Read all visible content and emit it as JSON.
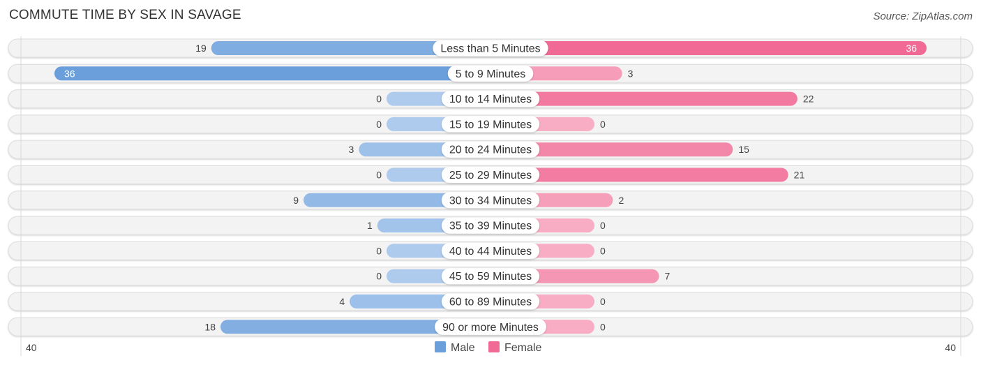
{
  "title": "COMMUTE TIME BY SEX IN SAVAGE",
  "source": "Source: ZipAtlas.com",
  "chart_data": {
    "type": "bar",
    "orientation": "horizontal-diverging",
    "title": "COMMUTE TIME BY SEX IN SAVAGE",
    "categories": [
      "Less than 5 Minutes",
      "5 to 9 Minutes",
      "10 to 14 Minutes",
      "15 to 19 Minutes",
      "20 to 24 Minutes",
      "25 to 29 Minutes",
      "30 to 34 Minutes",
      "35 to 39 Minutes",
      "40 to 44 Minutes",
      "45 to 59 Minutes",
      "60 to 89 Minutes",
      "90 or more Minutes"
    ],
    "series": [
      {
        "name": "Male",
        "color": "#6a9fdc",
        "values": [
          19,
          36,
          0,
          0,
          3,
          0,
          9,
          1,
          0,
          0,
          4,
          18
        ]
      },
      {
        "name": "Female",
        "color": "#f06a95",
        "values": [
          36,
          3,
          22,
          0,
          15,
          21,
          2,
          0,
          0,
          7,
          0,
          0
        ]
      }
    ],
    "axis": {
      "left_label": "40",
      "right_label": "40",
      "range": [
        0,
        40
      ]
    },
    "legend": {
      "placement": "bottom-center",
      "items": [
        "Male",
        "Female"
      ]
    }
  }
}
